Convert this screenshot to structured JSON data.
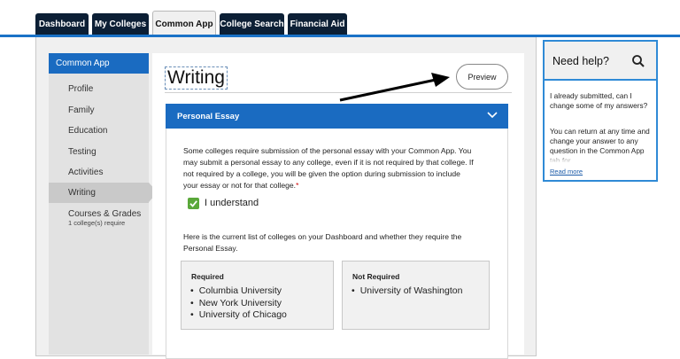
{
  "tabs": [
    {
      "label": "Dashboard"
    },
    {
      "label": "My Colleges"
    },
    {
      "label": "Common App"
    },
    {
      "label": "College Search"
    },
    {
      "label": "Financial Aid"
    }
  ],
  "sidebar": {
    "header": "Common App",
    "items": [
      {
        "label": "Profile"
      },
      {
        "label": "Family"
      },
      {
        "label": "Education"
      },
      {
        "label": "Testing"
      },
      {
        "label": "Activities"
      },
      {
        "label": "Writing"
      },
      {
        "label": "Courses & Grades"
      }
    ],
    "courses_sub": "1 college(s) require"
  },
  "main": {
    "title": "Writing",
    "preview_label": "Preview",
    "accordion": {
      "title": "Personal Essay",
      "body_text": "Some colleges require submission of the personal essay with your Common App. You may submit a personal essay to any college, even if it is not required by that college. If not required by a college, you will be given the option during submission to include your essay or not for that college.",
      "required_mark": "*",
      "checkbox_label": "I understand",
      "checked": true,
      "list_intro": "Here is the current list of colleges on your Dashboard and whether they require the Personal Essay.",
      "required_title": "Required",
      "required_list": [
        "Columbia University",
        "New York University",
        "University of Chicago"
      ],
      "not_required_title": "Not Required",
      "not_required_list": [
        "University of Washington"
      ]
    }
  },
  "help": {
    "title": "Need help?",
    "question": "I already submitted, can I change some of my answers?",
    "answer": "You can return at any time and change your answer to any question in the Common App tab for",
    "read_more": "Read more"
  },
  "colors": {
    "accent_blue": "#1a6bc1",
    "tab_dark": "#0c1f35",
    "check_green": "#5aa83a"
  }
}
